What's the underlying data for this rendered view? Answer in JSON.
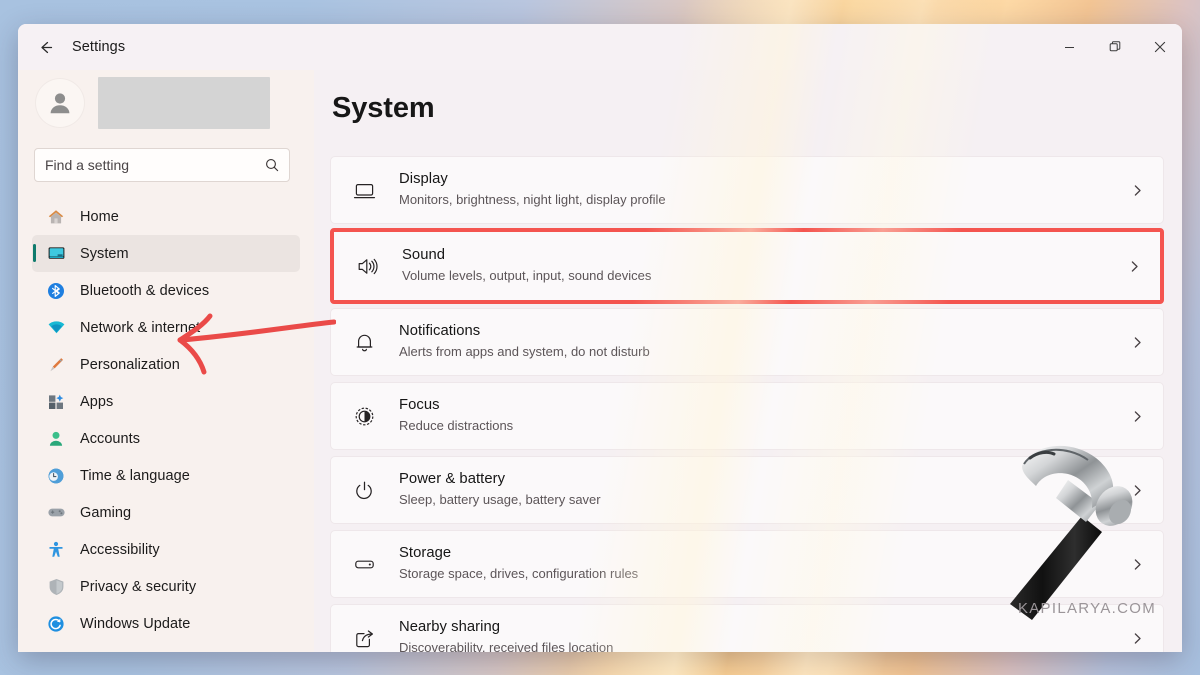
{
  "window": {
    "app_title": "Settings",
    "back_icon": "back-arrow-icon",
    "controls": {
      "minimize": "minimize-icon",
      "maximize": "maximize-icon",
      "close": "close-icon"
    }
  },
  "sidebar": {
    "account": {
      "avatar_icon": "person-avatar-icon",
      "name_redacted": "",
      "overflow": "...."
    },
    "search": {
      "placeholder": "Find a setting",
      "icon": "search-icon"
    },
    "items": [
      {
        "label": "Home",
        "icon": "home-icon",
        "selected": false
      },
      {
        "label": "System",
        "icon": "system-monitor-icon",
        "selected": true
      },
      {
        "label": "Bluetooth & devices",
        "icon": "bluetooth-icon",
        "selected": false
      },
      {
        "label": "Network & internet",
        "icon": "network-wifi-icon",
        "selected": false
      },
      {
        "label": "Personalization",
        "icon": "paintbrush-icon",
        "selected": false
      },
      {
        "label": "Apps",
        "icon": "apps-grid-icon",
        "selected": false
      },
      {
        "label": "Accounts",
        "icon": "accounts-person-icon",
        "selected": false
      },
      {
        "label": "Time & language",
        "icon": "clock-globe-icon",
        "selected": false
      },
      {
        "label": "Gaming",
        "icon": "gamepad-icon",
        "selected": false
      },
      {
        "label": "Accessibility",
        "icon": "accessibility-person-icon",
        "selected": false
      },
      {
        "label": "Privacy & security",
        "icon": "shield-icon",
        "selected": false
      },
      {
        "label": "Windows Update",
        "icon": "update-refresh-icon",
        "selected": false
      }
    ]
  },
  "main": {
    "page_title": "System",
    "cards": [
      {
        "title": "Display",
        "desc": "Monitors, brightness, night light, display profile",
        "icon": "display-monitor-icon",
        "highlighted": false
      },
      {
        "title": "Sound",
        "desc": "Volume levels, output, input, sound devices",
        "icon": "speaker-sound-icon",
        "highlighted": true
      },
      {
        "title": "Notifications",
        "desc": "Alerts from apps and system, do not disturb",
        "icon": "bell-icon",
        "highlighted": false
      },
      {
        "title": "Focus",
        "desc": "Reduce distractions",
        "icon": "focus-moon-icon",
        "highlighted": false
      },
      {
        "title": "Power & battery",
        "desc": "Sleep, battery usage, battery saver",
        "icon": "power-icon",
        "highlighted": false
      },
      {
        "title": "Storage",
        "desc": "Storage space, drives, configuration rules",
        "icon": "storage-drive-icon",
        "highlighted": false
      },
      {
        "title": "Nearby sharing",
        "desc": "Discoverability, received files location",
        "icon": "nearby-share-icon",
        "highlighted": false
      }
    ],
    "chevron_icon": "chevron-right-icon"
  },
  "annotations": {
    "arrow": "red-arrow-annotation",
    "arrow_color": "#ea4a48",
    "hammer": "hammer-tool-graphic",
    "watermark": "KAPILARYA.COM"
  },
  "colors": {
    "accent_selected": "#0f7b6c",
    "highlight_border": "#f4544f",
    "sidebar_bg": "#f8f1ee",
    "main_bg": "#f5f0f3",
    "card_bg": "#fbf9fa"
  }
}
